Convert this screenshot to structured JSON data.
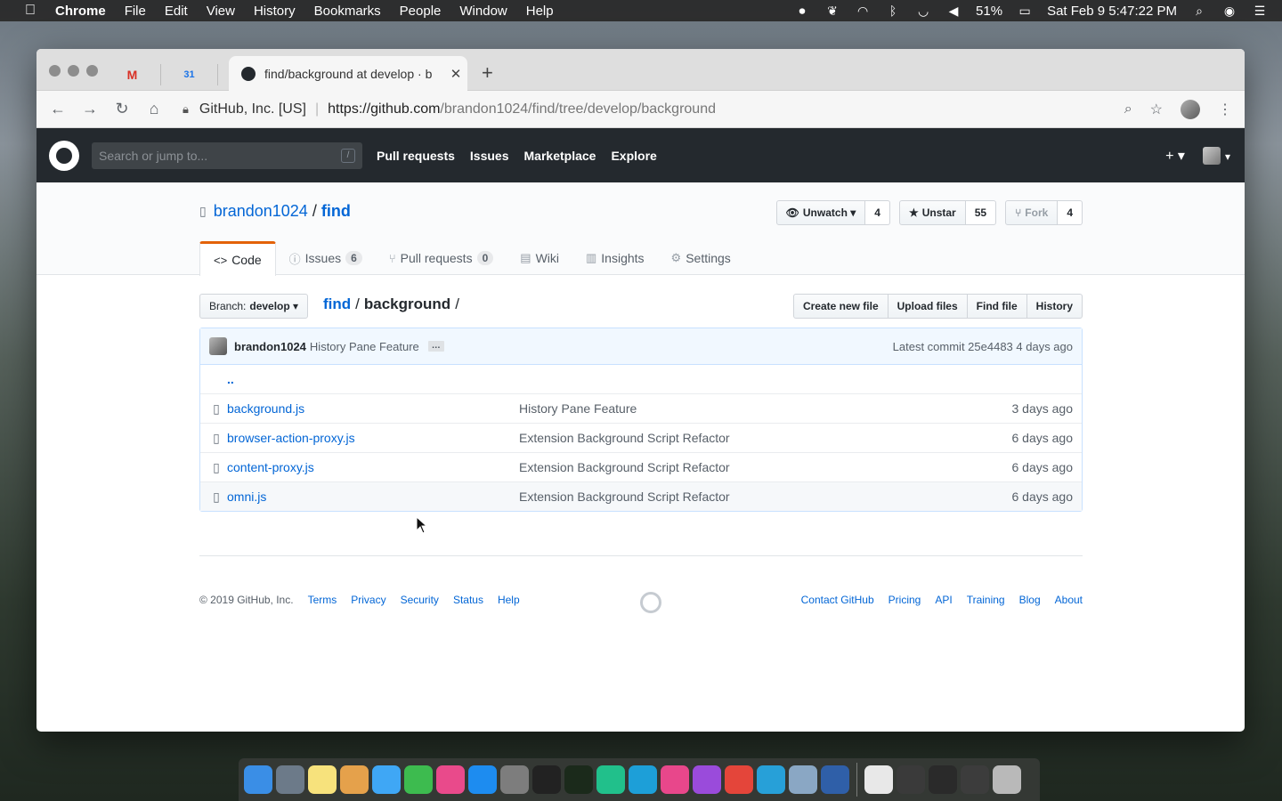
{
  "menubar": {
    "app_name": "Chrome",
    "items": [
      "File",
      "Edit",
      "View",
      "History",
      "Bookmarks",
      "People",
      "Window",
      "Help"
    ],
    "battery": "51%",
    "clock": "Sat Feb 9  5:47:22 PM"
  },
  "browser": {
    "pinned_tabs": [
      {
        "icon": "gmail-icon",
        "glyph": "M",
        "color": "#d93025"
      },
      {
        "icon": "calendar-icon",
        "glyph": "31",
        "color": "#1a73e8"
      },
      {
        "icon": "messenger-icon",
        "glyph": "●",
        "color": "#0084ff"
      }
    ],
    "active_tab_title": "find/background at develop · b",
    "address": {
      "org_label": "GitHub, Inc. [US]",
      "url_host": "https://github.com",
      "url_path": "/brandon1024/find/tree/develop/background"
    }
  },
  "github": {
    "search_placeholder": "Search or jump to...",
    "search_shortcut": "/",
    "nav": [
      "Pull requests",
      "Issues",
      "Marketplace",
      "Explore"
    ],
    "plus": "+ ▾",
    "avatar_caret": "▾"
  },
  "repo": {
    "owner": "brandon1024",
    "name": "find",
    "watch_label": "Unwatch",
    "watch_count": "4",
    "star_label": "Unstar",
    "star_count": "55",
    "fork_label": "Fork",
    "fork_count": "4",
    "tabs": [
      {
        "label": "Code",
        "icon": "code-icon",
        "glyph": "<>",
        "counter": null,
        "selected": true
      },
      {
        "label": "Issues",
        "icon": "issue-icon",
        "glyph": "ⓘ",
        "counter": "6"
      },
      {
        "label": "Pull requests",
        "icon": "pr-icon",
        "glyph": "⑂",
        "counter": "0"
      },
      {
        "label": "Wiki",
        "icon": "wiki-icon",
        "glyph": "▤",
        "counter": null
      },
      {
        "label": "Insights",
        "icon": "graph-icon",
        "glyph": "▥",
        "counter": null
      },
      {
        "label": "Settings",
        "icon": "gear-icon",
        "glyph": "⚙",
        "counter": null
      }
    ]
  },
  "filenav": {
    "branch_prefix": "Branch:",
    "branch": "develop",
    "crumb_root": "find",
    "crumb_current": "background",
    "actions": [
      "Create new file",
      "Upload files",
      "Find file",
      "History"
    ]
  },
  "commit": {
    "author": "brandon1024",
    "message": "History Pane Feature",
    "ellipsis": "…",
    "latest": "Latest commit 25e4483 4 days ago"
  },
  "files": {
    "up": "..",
    "rows": [
      {
        "name": "background.js",
        "message": "History Pane Feature",
        "age": "3 days ago"
      },
      {
        "name": "browser-action-proxy.js",
        "message": "Extension Background Script Refactor",
        "age": "6 days ago"
      },
      {
        "name": "content-proxy.js",
        "message": "Extension Background Script Refactor",
        "age": "6 days ago"
      },
      {
        "name": "omni.js",
        "message": "Extension Background Script Refactor",
        "age": "6 days ago"
      }
    ]
  },
  "footer": {
    "copyright": "© 2019 GitHub, Inc.",
    "left_links": [
      "Terms",
      "Privacy",
      "Security",
      "Status",
      "Help"
    ],
    "right_links": [
      "Contact GitHub",
      "Pricing",
      "API",
      "Training",
      "Blog",
      "About"
    ]
  },
  "dock": [
    {
      "name": "finder",
      "color": "#3a8ee6"
    },
    {
      "name": "launchpad",
      "color": "#6c7a89"
    },
    {
      "name": "notes",
      "color": "#f7e27c"
    },
    {
      "name": "photos",
      "color": "#e5a14b"
    },
    {
      "name": "messages",
      "color": "#3fa7f5"
    },
    {
      "name": "facetime",
      "color": "#3dbb4f"
    },
    {
      "name": "itunes",
      "color": "#e94a8b"
    },
    {
      "name": "app-store",
      "color": "#1d8cf0"
    },
    {
      "name": "system-preferences",
      "color": "#7d7d7d"
    },
    {
      "name": "terminal",
      "color": "#222222"
    },
    {
      "name": "activity-monitor",
      "color": "#1b2a1b"
    },
    {
      "name": "clion",
      "color": "#21c08b"
    },
    {
      "name": "webstorm",
      "color": "#1d9fd8"
    },
    {
      "name": "intellij",
      "color": "#e8478b"
    },
    {
      "name": "datagrip",
      "color": "#9a4bdb"
    },
    {
      "name": "chrome",
      "color": "#e4453a"
    },
    {
      "name": "webstorm-2",
      "color": "#27a0d8"
    },
    {
      "name": "preview",
      "color": "#8aa7c4"
    },
    {
      "name": "safari-ish",
      "color": "#2f5fa8"
    },
    {
      "name": "folder-1",
      "color": "#e8e8e8"
    },
    {
      "name": "folder-2",
      "color": "#3a3a3a"
    },
    {
      "name": "folder-3",
      "color": "#2a2a2a"
    },
    {
      "name": "folder-4",
      "color": "#3c3c3c"
    },
    {
      "name": "trash",
      "color": "#b9b9b9"
    }
  ]
}
